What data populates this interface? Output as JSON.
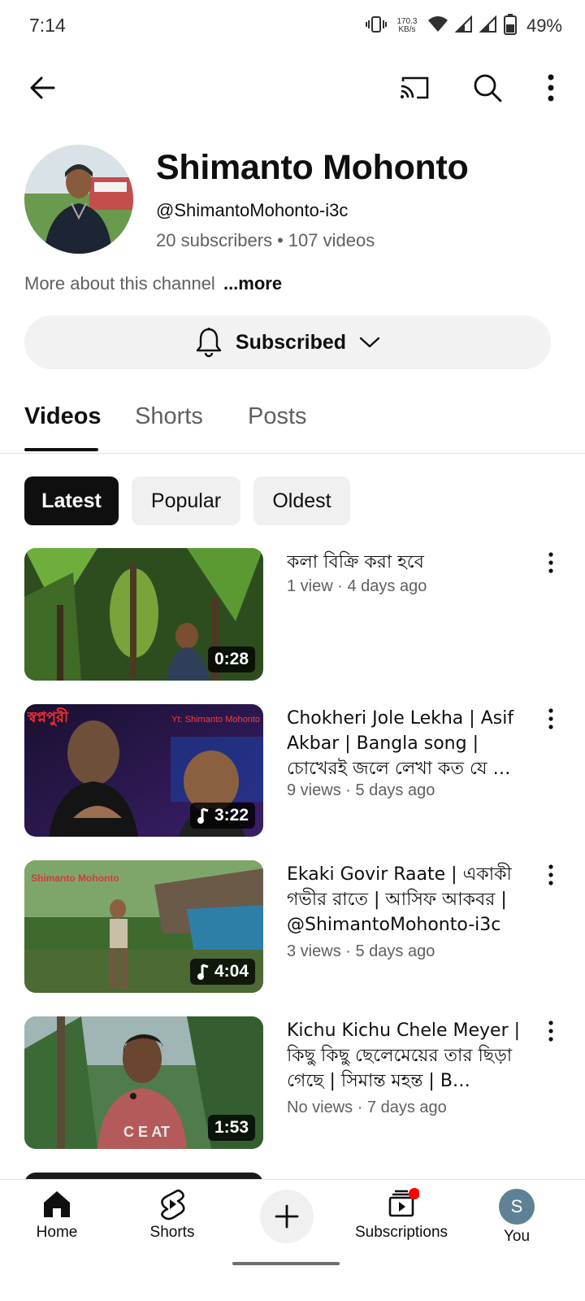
{
  "status_bar": {
    "time": "7:14",
    "net_speed_value": "170.3",
    "net_speed_unit": "KB/s",
    "battery": "49%"
  },
  "app_bar": {
    "back_icon": "arrow-left-icon",
    "cast_icon": "cast-icon",
    "search_icon": "search-icon",
    "more_icon": "more-vert-icon"
  },
  "channel": {
    "name": "Shimanto Mohonto",
    "handle": "@ShimantoMohonto-i3c",
    "subscribers": "20 subscribers",
    "separator": "•",
    "videos_count": "107 videos",
    "about": "More about this channel",
    "about_more": "...more",
    "subscribed_label": "Subscribed"
  },
  "tabs": [
    {
      "label": "Videos",
      "active": true
    },
    {
      "label": "Shorts",
      "active": false
    },
    {
      "label": "Posts",
      "active": false
    }
  ],
  "chips": [
    {
      "label": "Latest",
      "active": true
    },
    {
      "label": "Popular",
      "active": false
    },
    {
      "label": "Oldest",
      "active": false
    }
  ],
  "videos": [
    {
      "title": "কলা বিক্রি করা হবে",
      "meta": "1 view · 4 days ago",
      "duration": "0:28",
      "music": false
    },
    {
      "title": "Chokheri Jole Lekha | Asif Akbar | Bangla song | চোখেরই জলে লেখা কত যে …",
      "meta": "9 views · 5 days ago",
      "duration": "3:22",
      "music": true,
      "thumb_text_left": "স্বপ্নপুরী",
      "thumb_text_right": "Yt: Shimanto Mohonto"
    },
    {
      "title": "Ekaki Govir Raate | একাকী গভীর রাতে | আসিফ আকবর | @ShimantoMohonto-i3c",
      "meta": "3 views · 5 days ago",
      "duration": "4:04",
      "music": true,
      "thumb_text_left": "Shimanto Mohonto"
    },
    {
      "title": "Kichu Kichu Chele Meyer | কিছু কিছু ছেলেমেয়ের তার ছিড়া গেছে | সিমান্ত মহন্ত | B…",
      "meta": "No views · 7 days ago",
      "duration": "1:53",
      "music": false
    }
  ],
  "bottom_nav": {
    "home": "Home",
    "shorts": "Shorts",
    "subscriptions": "Subscriptions",
    "you": "You",
    "you_initial": "S"
  },
  "colors": {
    "text_primary": "#0f0f0f",
    "text_secondary": "#606060",
    "chip_bg": "#f0f0f0",
    "notification_red": "#ff0000",
    "you_avatar": "#5e8294"
  }
}
